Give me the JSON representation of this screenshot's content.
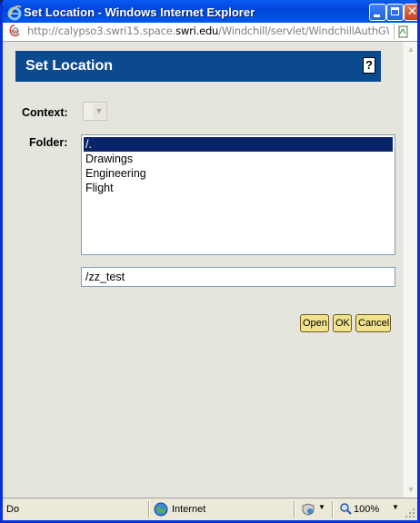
{
  "window": {
    "title": "Set Location - Windows Internet Explorer",
    "url_prefix": "http://calypso3.swri15.space.",
    "url_domain": "swri.edu",
    "url_suffix": "/Windchill/servlet/WindchillAuthGW/wt.ente",
    "controls": {
      "close": "✕"
    }
  },
  "dialog": {
    "title": "Set Location",
    "help_label": "?",
    "context_label": "Context:",
    "folder_label": "Folder:",
    "folders": [
      {
        "label": "/.",
        "selected": true
      },
      {
        "label": "Drawings",
        "selected": false
      },
      {
        "label": "Engineering",
        "selected": false
      },
      {
        "label": "Flight",
        "selected": false
      }
    ],
    "path_value": "/zz_test",
    "buttons": {
      "open": "Open",
      "ok": "OK",
      "cancel": "Cancel"
    }
  },
  "statusbar": {
    "text": "Do",
    "zone": "Internet",
    "zoom": "100%",
    "dropdown_glyph": "▼"
  },
  "icons": [
    "ie-logo-icon",
    "minimize-icon",
    "maximize-icon",
    "close-icon",
    "page-icon",
    "compat-view-icon",
    "globe-icon",
    "security-shield-icon",
    "zoom-icon",
    "resize-grip-icon",
    "scroll-up-icon",
    "scroll-down-icon",
    "dropdown-arrow-icon",
    "help-icon"
  ],
  "colors": {
    "titlebar": "#0054e3",
    "dialog_header": "#0c4a8f",
    "selection": "#0a246a",
    "button_fill": "#f1e28d",
    "content_bg": "#e5e5dd"
  }
}
